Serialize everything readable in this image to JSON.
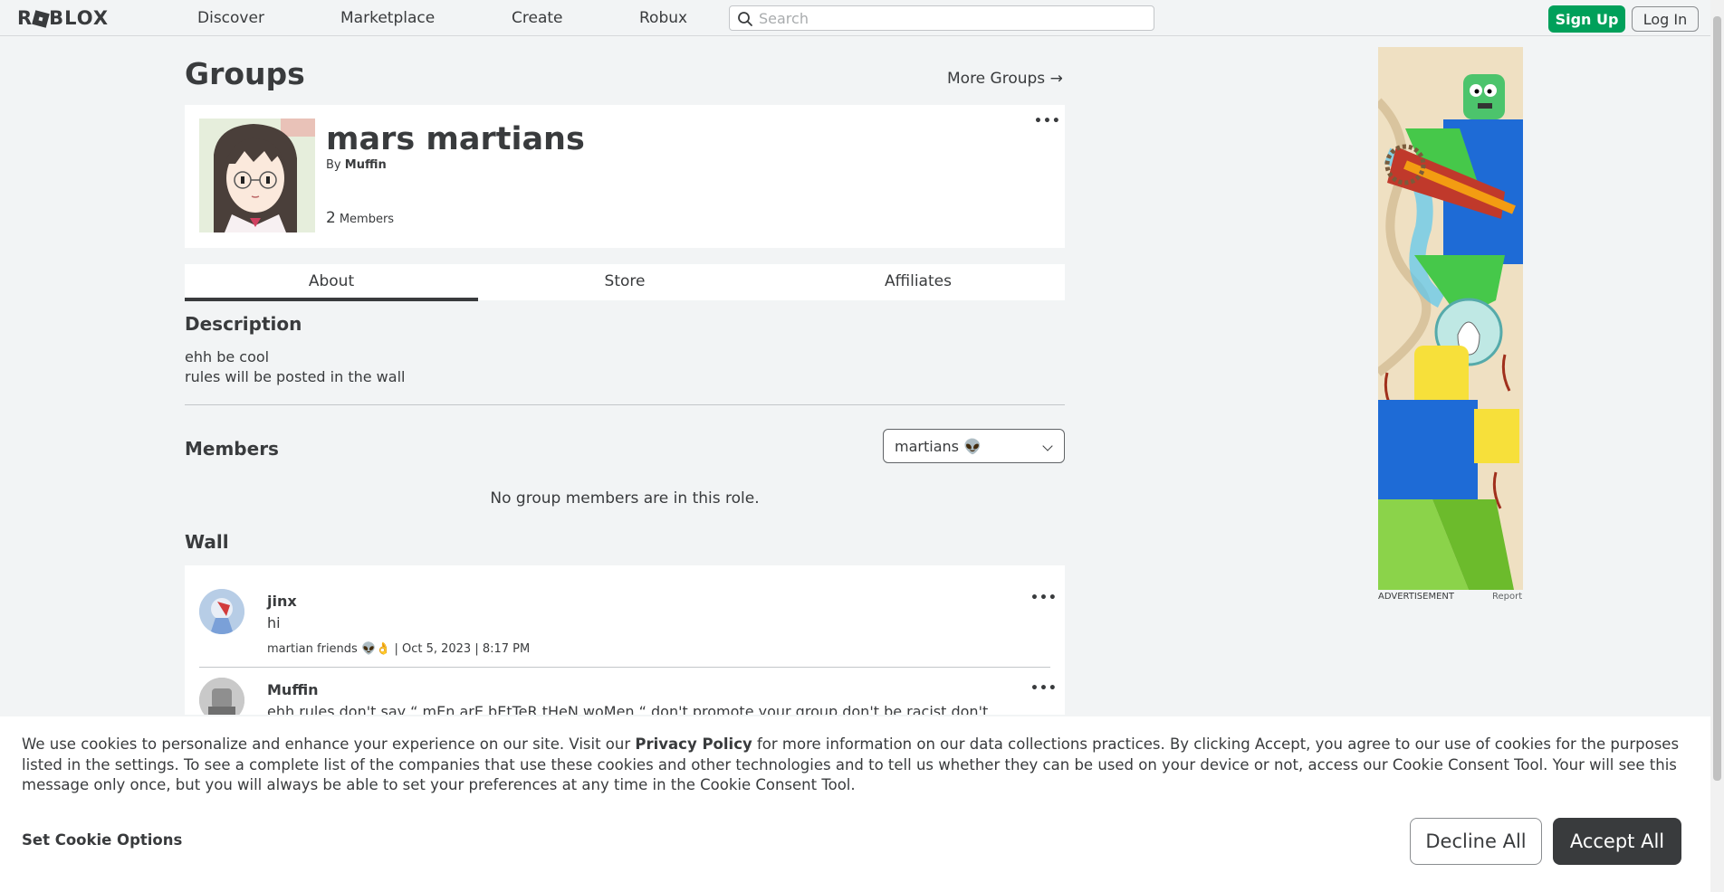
{
  "nav": {
    "logo": "ROBLOX",
    "links": [
      "Discover",
      "Marketplace",
      "Create",
      "Robux"
    ],
    "search_placeholder": "Search",
    "signup": "Sign Up",
    "login": "Log In"
  },
  "page": {
    "title": "Groups",
    "more_groups": "More Groups →"
  },
  "group": {
    "name": "mars martians",
    "by_prefix": "By",
    "owner": "Muffin",
    "member_count": "2",
    "members_label": "Members",
    "menu": "•••"
  },
  "tabs": [
    "About",
    "Store",
    "Affiliates"
  ],
  "about": {
    "description_heading": "Description",
    "description_lines": [
      "ehh be cool",
      "rules will be posted in the wall"
    ],
    "members_heading": "Members",
    "role_selected": "martians 👽",
    "empty_message": "No group members are in this role."
  },
  "wall": {
    "heading": "Wall",
    "posts": [
      {
        "author": "jinx",
        "body": "hi",
        "meta": "martian friends 👽👌 | Oct 5, 2023 | 8:17 PM",
        "menu": "•••"
      },
      {
        "author": "Muffin",
        "body": "ehh rules don't say “ mEn arE bEtTeR tHeN woMen “ don't promote your group don't be racist don't",
        "menu": "•••"
      }
    ]
  },
  "ad": {
    "label": "ADVERTISEMENT",
    "report": "Report"
  },
  "cookie": {
    "text_before": "We use cookies to personalize and enhance your experience on our site. Visit our",
    "privacy_link": "Privacy Policy",
    "text_after": "for more information on our data collections practices. By clicking Accept, you agree to our use of cookies for the purposes listed in the settings. To see a complete list of the companies that use these cookies and other technologies and to tell us whether they can be used on your device or not, access our Cookie Consent Tool. Your will see this message only once, but you will always be able to set your preferences at any time in the Cookie Consent Tool.",
    "set_options": "Set Cookie Options",
    "decline": "Decline All",
    "accept": "Accept All"
  }
}
